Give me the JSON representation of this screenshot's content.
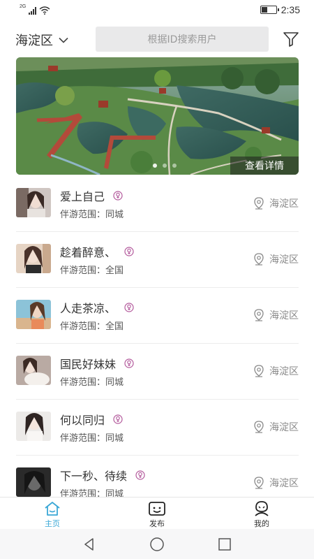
{
  "status_bar": {
    "network": "2G",
    "time": "2:35",
    "battery_level": 0.4
  },
  "header": {
    "region": "海淀区",
    "search_placeholder": "根据ID搜索用户"
  },
  "banner": {
    "button_label": "查看详情",
    "dot_count": 3,
    "active_dot": 0
  },
  "users": [
    {
      "name": "爱上自己",
      "scope": "伴游范围：同城",
      "location": "海淀区"
    },
    {
      "name": "趁着醉意、",
      "scope": "伴游范围：全国",
      "location": "海淀区"
    },
    {
      "name": "人走茶凉、",
      "scope": "伴游范围：全国",
      "location": "海淀区"
    },
    {
      "name": "国民好妹妹",
      "scope": "伴游范围：同城",
      "location": "海淀区"
    },
    {
      "name": "何以同归",
      "scope": "伴游范围：同城",
      "location": "海淀区"
    },
    {
      "name": "下一秒、待续",
      "scope": "伴游范围：同城",
      "location": "海淀区"
    }
  ],
  "nav": {
    "home": "主页",
    "publish": "发布",
    "mine": "我的"
  },
  "colors": {
    "accent": "#3aa7d6",
    "female_icon": "#b35a9c",
    "search_bg": "#e9e9ea"
  }
}
